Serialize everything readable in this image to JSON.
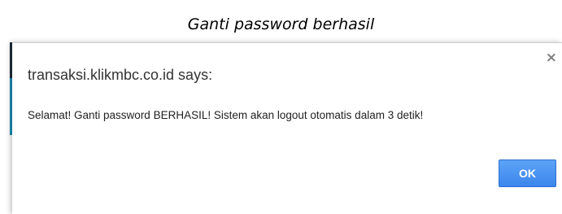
{
  "caption": "Ganti password berhasil",
  "dialog": {
    "title": "transaksi.klikmbc.co.id says:",
    "message": "Selamat! Ganti password BERHASIL! Sistem akan logout otomatis dalam 3 detik!",
    "ok_label": "OK",
    "close_icon": "close-icon",
    "close_glyph": "×"
  }
}
